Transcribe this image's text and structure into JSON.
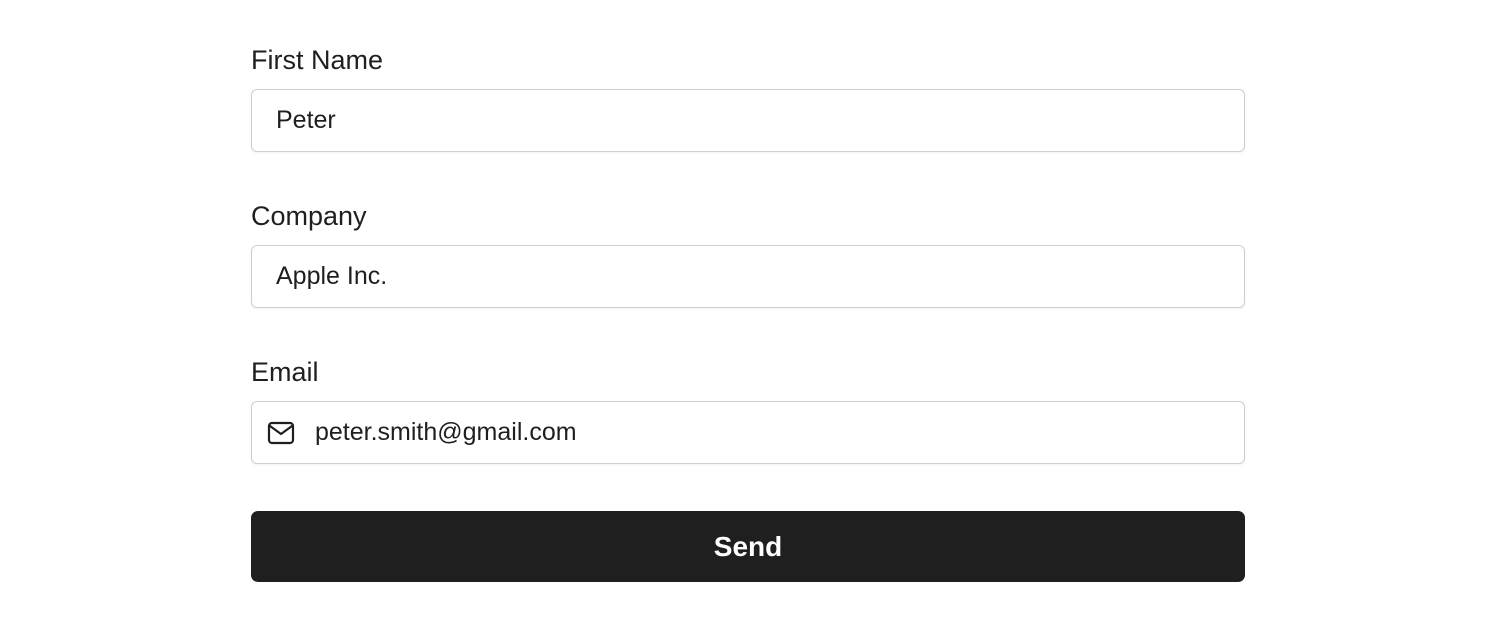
{
  "form": {
    "first_name": {
      "label": "First Name",
      "value": "Peter",
      "placeholder": ""
    },
    "company": {
      "label": "Company",
      "value": "Apple Inc.",
      "placeholder": ""
    },
    "email": {
      "label": "Email",
      "value": "peter.smith@gmail.com",
      "placeholder": "",
      "icon": "mail-icon"
    },
    "submit_label": "Send"
  },
  "colors": {
    "text": "#1f1f1f",
    "border": "#cfcfcf",
    "button_bg": "#1f1f1f",
    "button_text": "#ffffff",
    "background": "#ffffff"
  }
}
